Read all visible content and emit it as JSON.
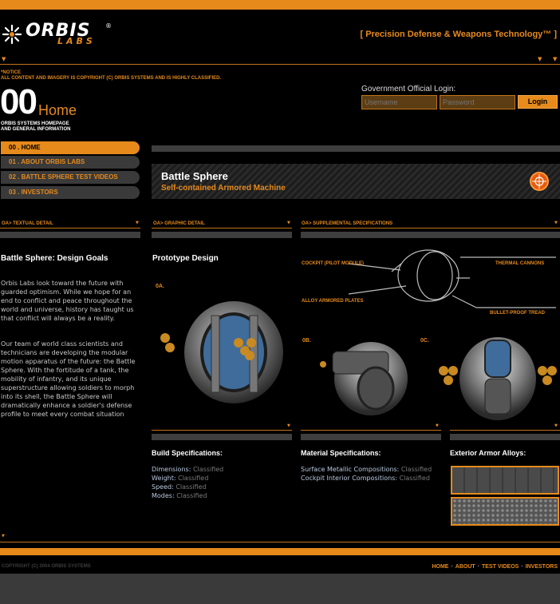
{
  "header": {
    "logo_text": "ORBIS",
    "logo_sub": "LABS",
    "logo_reg": "®",
    "tagline": "[ Precision Defense & Weapons Technology™ ]"
  },
  "notice": {
    "line1": "*NOTICE",
    "line2": "ALL CONTENT AND IMAGERY IS COPYRIGHT (C) ORBIS SYSTEMS AND IS HIGHLY CLASSIFIED."
  },
  "page": {
    "number": "00",
    "title": "Home",
    "sub1": "ORBIS SYSTEMS HOMEPAGE",
    "sub2": "AND GENERAL INFORMATION"
  },
  "login": {
    "label": "Government Official Login:",
    "username_placeholder": "Username",
    "password_placeholder": "Password",
    "button": "Login"
  },
  "nav": {
    "items": [
      {
        "label": "00 . HOME"
      },
      {
        "label": "01 . ABOUT ORBIS LABS"
      },
      {
        "label": "02 . BATTLE SPHERE TEST VIDEOS"
      },
      {
        "label": "03 . INVESTORS"
      }
    ]
  },
  "banner": {
    "title": "Battle Sphere",
    "subtitle": "Self-contained Armored Machine"
  },
  "sections": {
    "textual": "OA> TEXTUAL DETAIL",
    "graphic": "OA> GRAPHIC DETAIL",
    "supplemental": "OA> SUPPLEMENTAL SPECIFICATIONS"
  },
  "textual": {
    "heading": "Battle Sphere: Design Goals",
    "para1": "Orbis Labs look toward the future with guarded optimism. While we hope for an end to conflict and peace throughout the world and universe, history has taught us that conflict will always be a reality.",
    "para2": "Our team of world class scientists and technicians are developing the modular motion apparatus of the future: the Battle Sphere. With the fortitude of a tank, the mobility of infantry, and its unique superstructure allowing soldiers to morph into its shell, the Battle Sphere will dramatically enhance a soldier's defense profile to meet every combat situation"
  },
  "graphic": {
    "heading": "Prototype Design",
    "label_a": "0A.",
    "label_b": "0B.",
    "label_c": "0C."
  },
  "callouts": {
    "cockpit": "COCKPIT (PILOT MODULE)",
    "thermal": "THERMAL CANNONS",
    "alloy": "ALLOY ARMORED PLATES",
    "bullet": "BULLET-PROOF TREAD"
  },
  "build": {
    "heading": "Build Specifications:",
    "rows": [
      {
        "k": "Dimensions:",
        "v": "Classified"
      },
      {
        "k": "Weight:",
        "v": "Classified"
      },
      {
        "k": "Speed:",
        "v": "Classified"
      },
      {
        "k": "Modes:",
        "v": "Classified"
      }
    ]
  },
  "material": {
    "heading": "Material Specifications:",
    "rows": [
      {
        "k": "Surface Metallic Compositions:",
        "v": "Classified"
      },
      {
        "k": "Cockpit Interior Compositions:",
        "v": "Classified"
      }
    ]
  },
  "armor": {
    "heading": "Exterior Armor Alloys:"
  },
  "footer": {
    "copyright": "COPYRIGHT (C) 2004 ORBIS SYSTEMS",
    "links": [
      "HOME",
      "ABOUT",
      "TEST VIDEOS",
      "INVESTORS"
    ]
  },
  "colors": {
    "accent": "#e68a1c",
    "background": "#000000"
  }
}
